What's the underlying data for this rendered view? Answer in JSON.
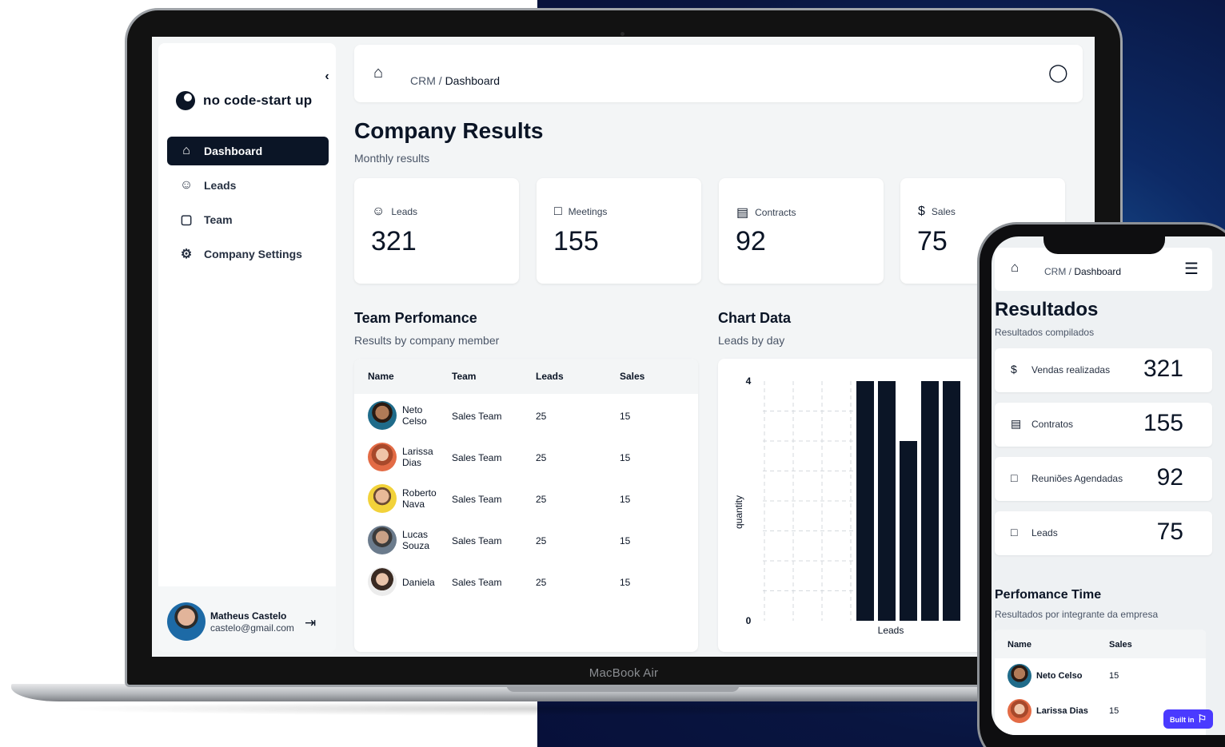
{
  "laptop": {
    "bezel_label": "MacBook Air",
    "sidebar": {
      "brand": "no code-start up",
      "items": [
        {
          "label": "Dashboard",
          "icon": "home-icon",
          "active": true
        },
        {
          "label": "Leads",
          "icon": "users-icon",
          "active": false
        },
        {
          "label": "Team",
          "icon": "briefcase-icon",
          "active": false
        },
        {
          "label": "Company Settings",
          "icon": "gear-icon",
          "active": false
        }
      ],
      "profile": {
        "name": "Matheus Castelo",
        "email": "castelo@gmail.com"
      }
    },
    "topbar": {
      "crumb_root": "CRM",
      "crumb_sep": " / ",
      "crumb_current": "Dashboard"
    },
    "header": {
      "title": "Company Results",
      "subtitle": "Monthly results"
    },
    "stats": [
      {
        "label": "Leads",
        "value": "321",
        "icon": "smile-icon"
      },
      {
        "label": "Meetings",
        "value": "155",
        "icon": "chat-icon"
      },
      {
        "label": "Contracts",
        "value": "92",
        "icon": "clipboard-icon"
      },
      {
        "label": "Sales",
        "value": "75",
        "icon": "dollar-icon"
      }
    ],
    "team": {
      "title": "Team Perfomance",
      "subtitle": "Results by company member",
      "columns": [
        "Name",
        "Team",
        "Leads",
        "Sales"
      ],
      "rows": [
        {
          "name": "Neto Celso",
          "team": "Sales Team",
          "leads": "25",
          "sales": "15"
        },
        {
          "name": "Larissa Dias",
          "team": "Sales Team",
          "leads": "25",
          "sales": "15"
        },
        {
          "name": "Roberto Nava",
          "team": "Sales Team",
          "leads": "25",
          "sales": "15"
        },
        {
          "name": "Lucas Souza",
          "team": "Sales Team",
          "leads": "25",
          "sales": "15"
        },
        {
          "name": "Daniela",
          "team": "Sales Team",
          "leads": "25",
          "sales": "15"
        }
      ]
    },
    "chart": {
      "title": "Chart Data",
      "subtitle": "Leads by day"
    }
  },
  "chart_data": {
    "type": "bar",
    "ylabel": "quantity",
    "xlabel": "Leads",
    "ylim": [
      0,
      4
    ],
    "yticks": [
      "0",
      "4"
    ],
    "values": [
      4,
      4,
      3,
      4,
      4
    ],
    "color": "#0b1526"
  },
  "phone": {
    "topbar": {
      "crumb_root": "CRM",
      "crumb_sep": " / ",
      "crumb_current": "Dashboard"
    },
    "title": "Resultados",
    "subtitle": "Resultados compilados",
    "stats": [
      {
        "label": "Vendas realizadas",
        "value": "321",
        "icon": "dollar-icon"
      },
      {
        "label": "Contratos",
        "value": "155",
        "icon": "clipboard-icon"
      },
      {
        "label": "Reuniões Agendadas",
        "value": "92",
        "icon": "chat-icon"
      },
      {
        "label": "Leads",
        "value": "75",
        "icon": "chat-icon"
      }
    ],
    "section_title": "Perfomance Time",
    "section_subtitle": "Resultados por integrante da empresa",
    "columns": [
      "Name",
      "Sales"
    ],
    "rows": [
      {
        "name": "Neto Celso",
        "sales": "15"
      },
      {
        "name": "Larissa Dias",
        "sales": "15"
      }
    ],
    "badge": "Built in"
  }
}
